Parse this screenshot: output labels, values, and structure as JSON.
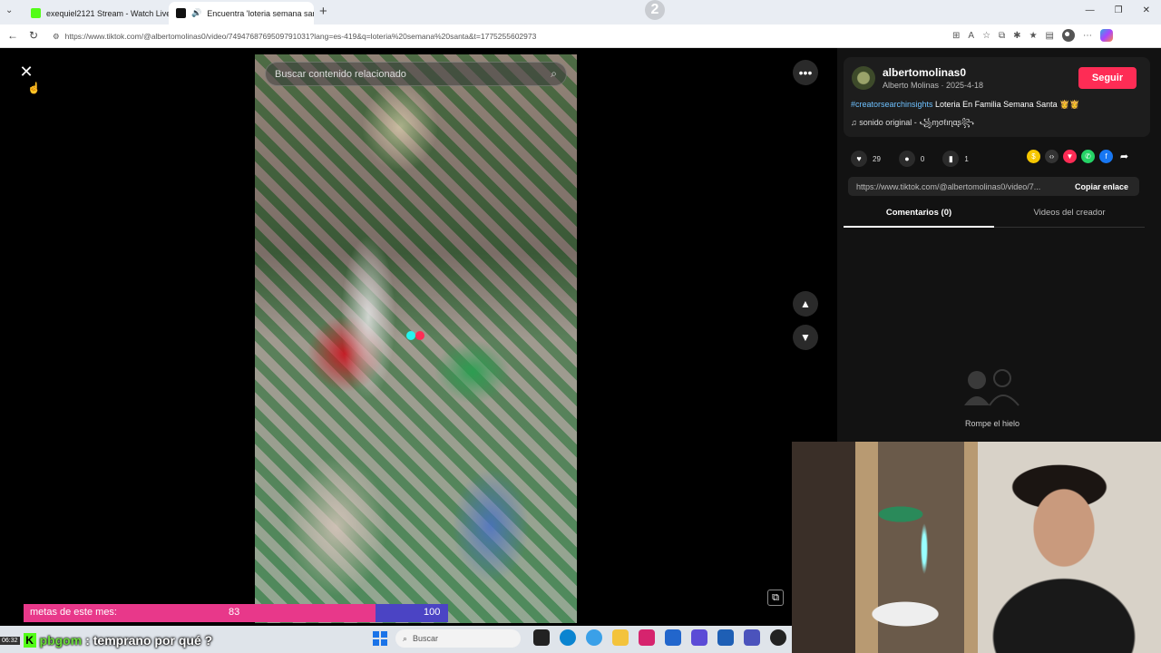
{
  "browser": {
    "tabs": [
      {
        "title": "exequiel2121 Stream - Watch Live",
        "active": false
      },
      {
        "title": "Encuentra 'loteria semana sant",
        "active": true
      }
    ],
    "new_tab": "+",
    "window_badge": "2",
    "url": "https://www.tiktok.com/@albertomolinas0/video/7494768769509791031?lang=es-419&q=loteria%20semana%20santa&t=1775255602973"
  },
  "video": {
    "search_placeholder": "Buscar contenido relacionado",
    "close_label": "✕",
    "more_label": "•••",
    "up_label": "▲",
    "down_label": "▼"
  },
  "post": {
    "username": "albertomolinas0",
    "display_name": "Alberto Molinas",
    "separator": " · ",
    "date": "2025-4-18",
    "follow_label": "Seguir",
    "hashtag": "#creatorsearchinsights",
    "caption_text": " Loteria En Familia Semana Santa 👸👸",
    "sound_prefix": "sonido original - ",
    "sound_author": "꧁ɱσℓιɳαʂ꧂",
    "likes": "29",
    "comments": "0",
    "saves": "1",
    "link": "https://www.tiktok.com/@albertomolinas0/video/7...",
    "copy_link_label": "Copiar enlace",
    "tab_comments": "Comentarios (0)",
    "tab_videos": "Videos del creador",
    "empty_comments": "Rompe el hielo"
  },
  "overlay": {
    "goal_label": "metas de este mes:",
    "goal_current": "83",
    "goal_max": "100",
    "goal_progress": 0.83,
    "chat_time": "06:32",
    "chat_user": "pbgom",
    "chat_message": ": temprano por qué ?"
  },
  "taskbar": {
    "search_placeholder": "Buscar"
  },
  "colors": {
    "tiktok_red": "#fe2c55",
    "tiktok_cyan": "#25f4ee",
    "goal_pink": "#e8388a",
    "goal_blue": "#4b44c4",
    "kick_green": "#53fc18"
  }
}
